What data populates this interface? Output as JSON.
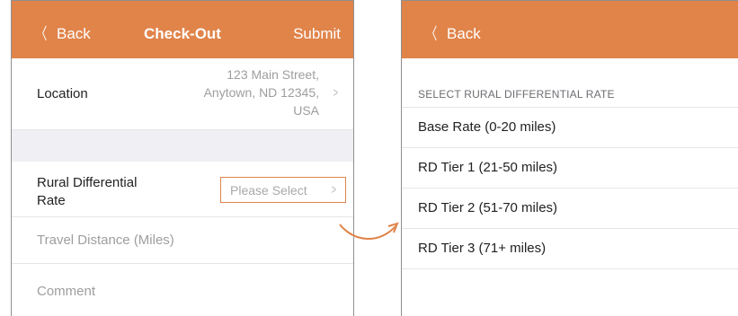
{
  "colors": {
    "accent": "#e0844a",
    "nav_text": "#ffffff",
    "group_bg": "#efeff4"
  },
  "left": {
    "nav": {
      "back_label": "Back",
      "title": "Check-Out",
      "submit_label": "Submit"
    },
    "location": {
      "label": "Location",
      "value_lines": [
        "123 Main Street,",
        "Anytown, ND 12345,",
        "USA"
      ]
    },
    "rural": {
      "label_lines": [
        "Rural Differential",
        "Rate"
      ],
      "placeholder": "Please Select"
    },
    "travel": {
      "placeholder": "Travel Distance (Miles)"
    },
    "comment": {
      "placeholder": "Comment"
    }
  },
  "right": {
    "nav": {
      "back_label": "Back"
    },
    "section_header": "SELECT RURAL DIFFERENTIAL RATE",
    "options": [
      "Base Rate (0-20 miles)",
      "RD Tier 1 (21-50 miles)",
      "RD Tier 2 (51-70 miles)",
      "RD Tier 3 (71+ miles)"
    ]
  },
  "icons": {
    "back": "chevron-left-icon",
    "disclosure": "chevron-right-icon",
    "connector": "curved-arrow-icon"
  }
}
